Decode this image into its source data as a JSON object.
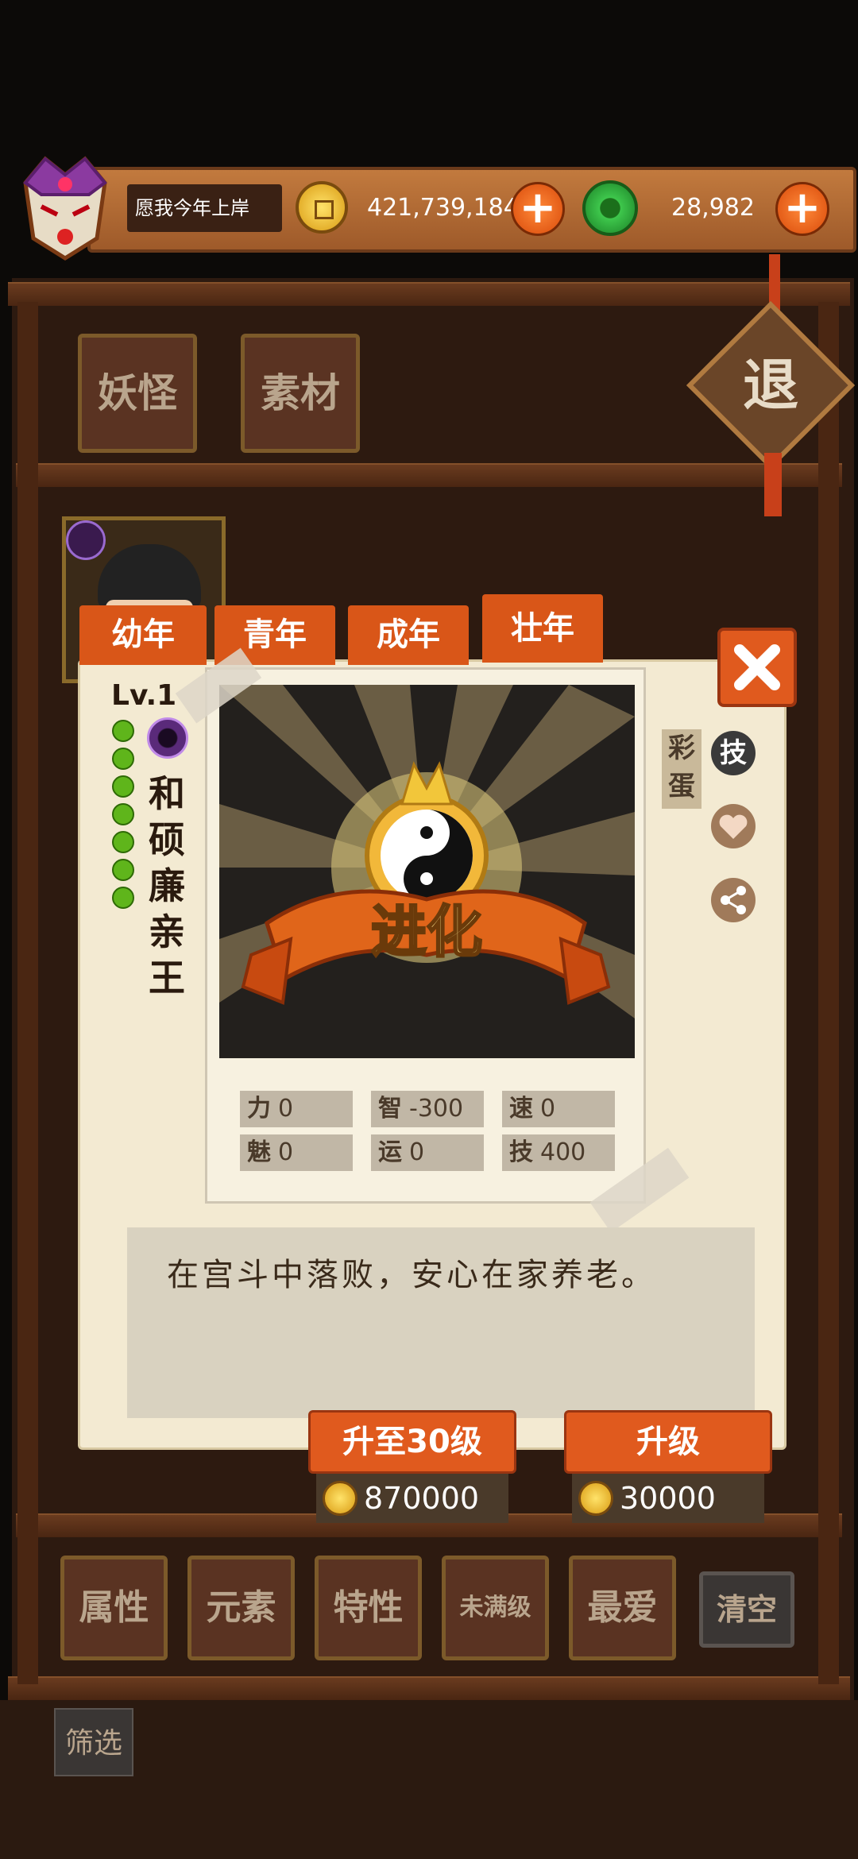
{
  "hud": {
    "player_name": "愿我今年上岸",
    "coins": "421,739,184",
    "jade": "28,982"
  },
  "top_tabs": [
    "妖怪",
    "素材"
  ],
  "retreat_label": "退",
  "age_tabs": [
    "幼年",
    "青年",
    "成年",
    "壮年"
  ],
  "card": {
    "level": "Lv.1",
    "name": "和硕廉亲王",
    "art_caption": "进化",
    "easter_egg": "彩蛋",
    "skill_badge": "技",
    "stats": [
      {
        "key": "力",
        "val": "0"
      },
      {
        "key": "智",
        "val": "-300"
      },
      {
        "key": "速",
        "val": "0"
      },
      {
        "key": "魅",
        "val": "0"
      },
      {
        "key": "运",
        "val": "0"
      },
      {
        "key": "技",
        "val": "400"
      }
    ]
  },
  "description": "在宫斗中落败，安心在家养老。",
  "actions": {
    "upgrade_30_label": "升至30级",
    "upgrade_30_cost": "870000",
    "upgrade_label": "升级",
    "upgrade_cost": "30000"
  },
  "filters": [
    "属性",
    "元素",
    "特性",
    "未满级",
    "最爱",
    "清空"
  ],
  "bottom": {
    "filter_label": "筛选"
  },
  "colors": {
    "accent": "#e05a1e",
    "wood": "#4a2612",
    "panel": "#f3ead2"
  }
}
